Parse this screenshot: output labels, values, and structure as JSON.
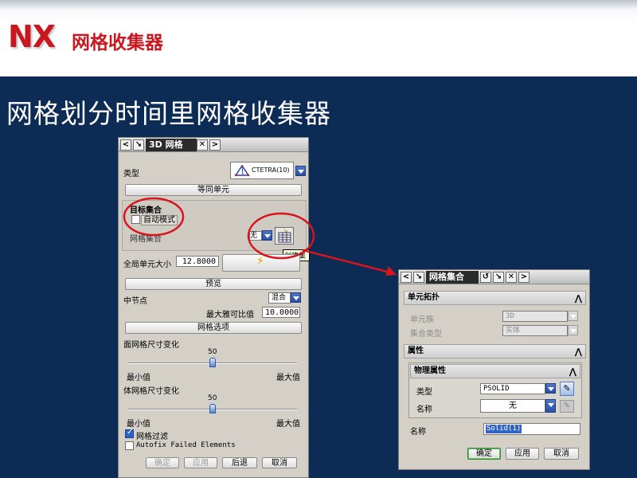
{
  "slide": {
    "logo": "NX",
    "header_title": "网格收集器",
    "title": "网格划分时间里网格收集器"
  },
  "colors": {
    "accent_red": "#c8171f",
    "background_blue": "#0d2c55"
  },
  "dialog_3d": {
    "title": "3D 网格",
    "type_label": "类型",
    "type_value": "CTETRA(10)",
    "element_properties_button": "等同单元",
    "target_collector_heading": "目标集合",
    "auto_mode_label": "自动模式",
    "auto_mode_checked": false,
    "mesh_collector_label": "网格集合",
    "mesh_collector_value": "无",
    "create_tooltip": "创建集",
    "global_size_label": "全局单元大小",
    "global_size_value": "12.8000",
    "preview_button": "预览",
    "midnode_label": "中节点",
    "midnode_value": "混合",
    "max_jacobian_label": "最大雅可比值",
    "max_jacobian_value": "10.0000",
    "mesh_options_button": "网格选项",
    "surface_size_label": "面网格尺寸变化",
    "surface_size_value": "50",
    "volume_size_label": "体网格尺寸变化",
    "volume_size_value": "50",
    "min_label": "最小值",
    "max_label": "最大值",
    "mesh_filter_label": "网格过滤",
    "mesh_filter_checked": true,
    "autofix_label": "Autofix Failed Elements",
    "autofix_checked": false,
    "ok_button": "确定",
    "apply_button": "应用",
    "back_button": "后退",
    "cancel_button": "取消"
  },
  "dialog_collector": {
    "title": "网格集合",
    "element_topology_heading": "单元拓扑",
    "element_family_label": "单元族",
    "element_family_value": "3D",
    "collector_type_label": "集合类型",
    "collector_type_value": "实体",
    "properties_heading": "属性",
    "physical_properties_heading": "物理属性",
    "prop_type_label": "类型",
    "prop_type_value": "PSOLID",
    "prop_name_label": "名称",
    "prop_name_value": "无",
    "name_label": "名称",
    "name_value": "Solid(1)",
    "ok_button": "确定",
    "apply_button": "应用",
    "cancel_button": "取消"
  }
}
